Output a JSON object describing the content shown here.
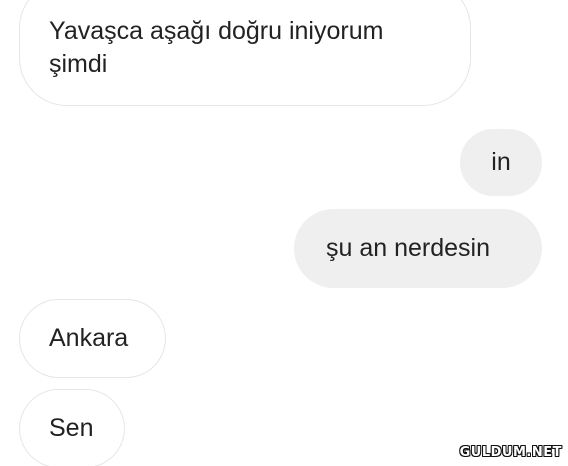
{
  "messages": [
    {
      "side": "incoming",
      "text": "Yavaşca aşağı doğru iniyorum\nşimdi"
    },
    {
      "side": "outgoing",
      "text": "in"
    },
    {
      "side": "outgoing",
      "text": "şu an nerdesin"
    },
    {
      "side": "incoming",
      "text": "Ankara"
    },
    {
      "side": "incoming",
      "text": "Sen"
    }
  ],
  "watermark": "GULDUM.NET",
  "colors": {
    "incoming_bubble": "#ffffff",
    "incoming_border": "#e6e6e6",
    "outgoing_bubble": "#efefef",
    "text": "#222222",
    "background": "#ffffff"
  }
}
